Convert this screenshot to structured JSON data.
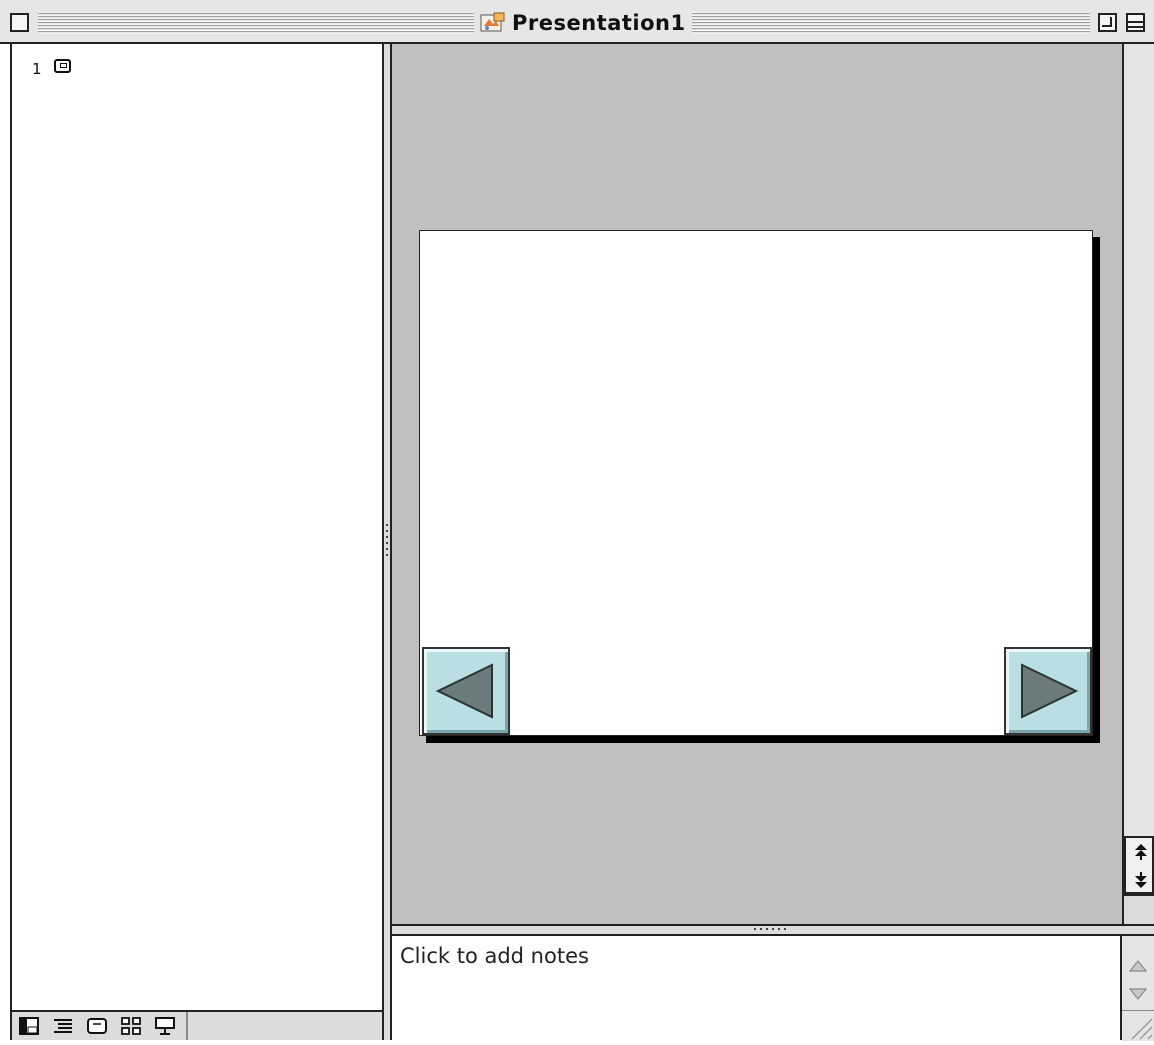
{
  "window": {
    "title": "Presentation1"
  },
  "outline": {
    "slide_number": "1"
  },
  "notes": {
    "placeholder": "Click to add notes"
  },
  "colors": {
    "slide_area_background": "#c0c0c0",
    "nav_button_fill": "#b9dfe3",
    "nav_arrow_fill": "#6b7b7c"
  },
  "icons": {
    "close": "close-box-icon",
    "zoom": "zoom-box-icon",
    "collapse": "collapse-box-icon",
    "document": "powerpoint-document-icon",
    "views": [
      "normal-view-icon",
      "outline-view-icon",
      "slide-view-icon",
      "slide-sorter-view-icon",
      "slide-show-icon"
    ]
  }
}
